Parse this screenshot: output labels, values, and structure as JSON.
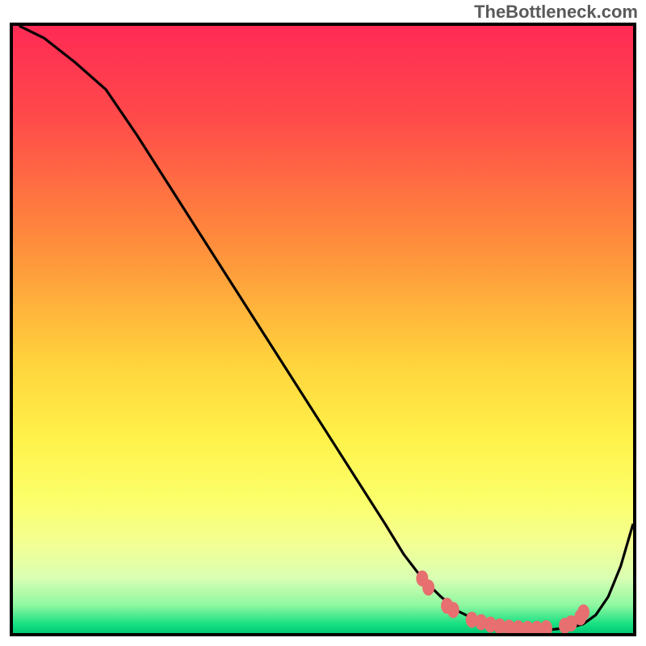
{
  "watermark": "TheBottleneck.com",
  "chart_data": {
    "type": "line",
    "title": "",
    "xlabel": "",
    "ylabel": "",
    "xlim": [
      0,
      100
    ],
    "ylim": [
      0,
      100
    ],
    "gradient_stops": [
      {
        "offset": 0.0,
        "color": "#ff2a55"
      },
      {
        "offset": 0.15,
        "color": "#ff4a4a"
      },
      {
        "offset": 0.35,
        "color": "#ff8a3c"
      },
      {
        "offset": 0.55,
        "color": "#ffd23c"
      },
      {
        "offset": 0.68,
        "color": "#fff24a"
      },
      {
        "offset": 0.78,
        "color": "#fcff6a"
      },
      {
        "offset": 0.85,
        "color": "#f4ff92"
      },
      {
        "offset": 0.91,
        "color": "#d9ffb3"
      },
      {
        "offset": 0.955,
        "color": "#8cf7a0"
      },
      {
        "offset": 0.985,
        "color": "#18e082"
      },
      {
        "offset": 1.0,
        "color": "#00c874"
      }
    ],
    "series": [
      {
        "name": "curve",
        "x": [
          1,
          5,
          10,
          15,
          20,
          25,
          30,
          35,
          40,
          45,
          50,
          55,
          60,
          63,
          66,
          69,
          72,
          75,
          78,
          81,
          84,
          87,
          90,
          92,
          94,
          96,
          98,
          100
        ],
        "y": [
          100,
          98,
          94,
          89.5,
          82,
          74,
          66,
          58,
          50,
          42,
          34,
          26,
          18,
          13,
          9,
          6,
          3.5,
          2,
          1.2,
          0.8,
          0.6,
          0.6,
          0.9,
          1.5,
          3,
          6,
          11,
          18
        ]
      }
    ],
    "markers": {
      "name": "highlight-dots",
      "color": "#e76f6f",
      "points": [
        {
          "x": 66,
          "y": 9
        },
        {
          "x": 67,
          "y": 7.5
        },
        {
          "x": 70,
          "y": 4.5
        },
        {
          "x": 71,
          "y": 3.8
        },
        {
          "x": 74,
          "y": 2.2
        },
        {
          "x": 75.5,
          "y": 1.8
        },
        {
          "x": 77,
          "y": 1.4
        },
        {
          "x": 78.5,
          "y": 1.1
        },
        {
          "x": 80,
          "y": 0.9
        },
        {
          "x": 81.5,
          "y": 0.8
        },
        {
          "x": 83,
          "y": 0.7
        },
        {
          "x": 84.5,
          "y": 0.7
        },
        {
          "x": 86,
          "y": 0.8
        },
        {
          "x": 89,
          "y": 1.2
        },
        {
          "x": 90,
          "y": 1.6
        },
        {
          "x": 91.5,
          "y": 2.6
        },
        {
          "x": 92,
          "y": 3.4
        }
      ]
    }
  }
}
